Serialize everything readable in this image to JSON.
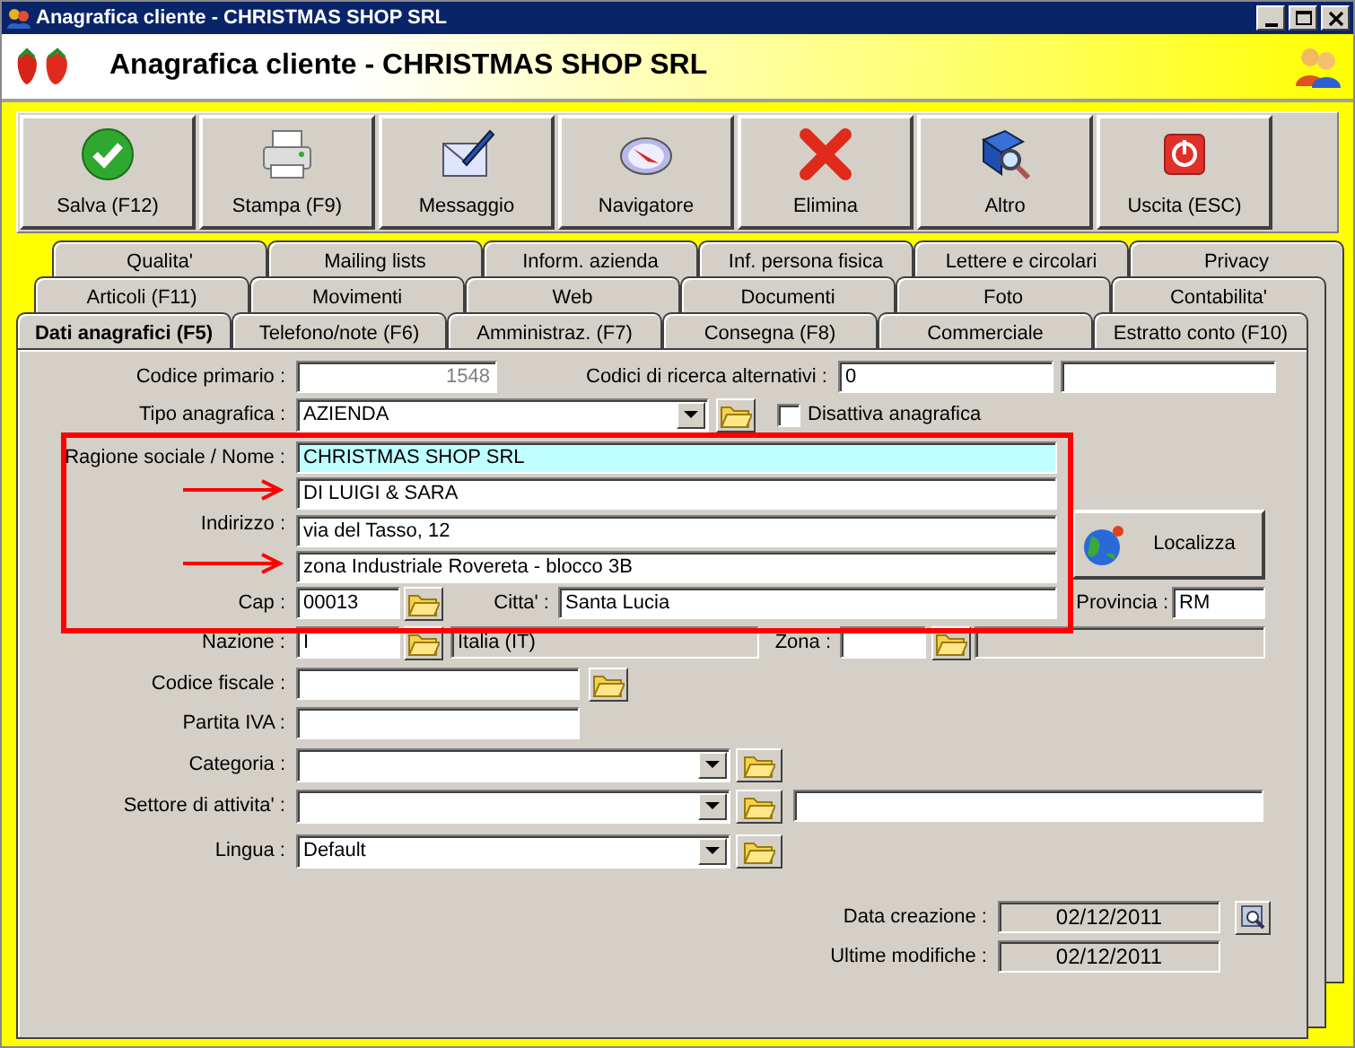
{
  "window": {
    "title": "Anagrafica cliente - CHRISTMAS SHOP SRL"
  },
  "header": {
    "title": "Anagrafica cliente - CHRISTMAS SHOP SRL"
  },
  "toolbar": [
    {
      "label": "Salva (F12)",
      "kind": "save"
    },
    {
      "label": "Stampa (F9)",
      "kind": "print"
    },
    {
      "label": "Messaggio",
      "kind": "message"
    },
    {
      "label": "Navigatore",
      "kind": "navigator"
    },
    {
      "label": "Elimina",
      "kind": "delete"
    },
    {
      "label": "Altro",
      "kind": "other"
    },
    {
      "label": "Uscita (ESC)",
      "kind": "exit"
    }
  ],
  "tab_rows": [
    [
      {
        "label": "Qualita'",
        "selected": false
      },
      {
        "label": "Mailing lists",
        "selected": false
      },
      {
        "label": "Inform. azienda",
        "selected": false
      },
      {
        "label": "Inf. persona fisica",
        "selected": false
      },
      {
        "label": "Lettere e circolari",
        "selected": false
      },
      {
        "label": "Privacy",
        "selected": false
      }
    ],
    [
      {
        "label": "Articoli (F11)",
        "selected": false
      },
      {
        "label": "Movimenti",
        "selected": false
      },
      {
        "label": "Web",
        "selected": false
      },
      {
        "label": "Documenti",
        "selected": false
      },
      {
        "label": "Foto",
        "selected": false
      },
      {
        "label": "Contabilita'",
        "selected": false
      }
    ],
    [
      {
        "label": "Dati anagrafici (F5)",
        "selected": true
      },
      {
        "label": "Telefono/note (F6)",
        "selected": false
      },
      {
        "label": "Amministraz. (F7)",
        "selected": false
      },
      {
        "label": "Consegna (F8)",
        "selected": false
      },
      {
        "label": "Commerciale",
        "selected": false
      },
      {
        "label": "Estratto conto (F10)",
        "selected": false
      }
    ]
  ],
  "form": {
    "codice_primario": {
      "label": "Codice primario :",
      "value": "1548"
    },
    "codici_alternativi": {
      "label": "Codici di ricerca alternativi :",
      "value": "0"
    },
    "tipo_anagrafica": {
      "label": "Tipo anagrafica :",
      "value": "AZIENDA"
    },
    "disattiva": {
      "label": "Disattiva anagrafica",
      "checked": false
    },
    "ragione_sociale": {
      "label": "Ragione sociale / Nome :",
      "lines": [
        "CHRISTMAS SHOP SRL",
        "DI LUIGI & SARA"
      ],
      "focused": true
    },
    "indirizzo": {
      "label": "Indirizzo :",
      "lines": [
        "via del Tasso, 12",
        "zona Industriale Rovereta - blocco 3B"
      ]
    },
    "cap": {
      "label": "Cap :",
      "value": "00013"
    },
    "citta": {
      "label": "Citta' :",
      "value": "Santa Lucia"
    },
    "localizza": {
      "label": "Localizza"
    },
    "provincia": {
      "label": "Provincia :",
      "value": "RM"
    },
    "nazione": {
      "label": "Nazione :",
      "value": "I",
      "description": "Italia (IT)"
    },
    "zona": {
      "label": "Zona :"
    },
    "codice_fiscale": {
      "label": "Codice fiscale :"
    },
    "partita_iva": {
      "label": "Partita IVA :"
    },
    "categoria": {
      "label": "Categoria :"
    },
    "settore": {
      "label": "Settore di attivita' :"
    },
    "lingua": {
      "label": "Lingua :",
      "value": "Default"
    },
    "data_creazione": {
      "label": "Data creazione :",
      "value": "02/12/2011"
    },
    "ultime_modifiche": {
      "label": "Ultime modifiche :",
      "value": "02/12/2011"
    }
  }
}
